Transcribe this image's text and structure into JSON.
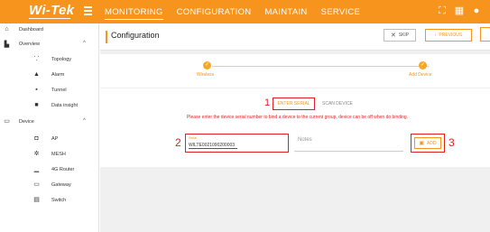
{
  "header": {
    "logo": "Wi-Tek",
    "nav": [
      "MONITORING",
      "CONFIGURATION",
      "MAINTAIN",
      "SERVICE"
    ],
    "active_nav": "MONITORING",
    "icons": [
      "fullscreen-icon",
      "qrcode-icon",
      "message-icon",
      "user-icon"
    ]
  },
  "sidebar": {
    "dashboard": "Dashboard",
    "overview": "Overview",
    "overview_items": [
      "Topology",
      "Alarm",
      "Tunnel",
      "Data insight"
    ],
    "device": "Device",
    "device_items": [
      "AP",
      "MESH",
      "4G Router",
      "Gateway",
      "Switch"
    ]
  },
  "page": {
    "title": "Configuration",
    "skip_label": "SKIP",
    "previous_label": "PREVIOUS"
  },
  "steps": {
    "step1": "Wireless",
    "step2": "Add Device"
  },
  "tabs": {
    "num1": "1",
    "enter_serial": "ENTER SERIAL",
    "scan_device": "SCAN DEVICE"
  },
  "warning": "Please enter the device serial number to bind a device to the current group, device can be off when do binding.",
  "form": {
    "num2": "2",
    "serial_label": "Serial",
    "serial_value": "WILTE0021090200003",
    "notes_placeholder": "Notes",
    "add_label": "ADD",
    "num3": "3"
  },
  "colors": {
    "brand": "#f7941d",
    "highlight": "#e02020"
  }
}
